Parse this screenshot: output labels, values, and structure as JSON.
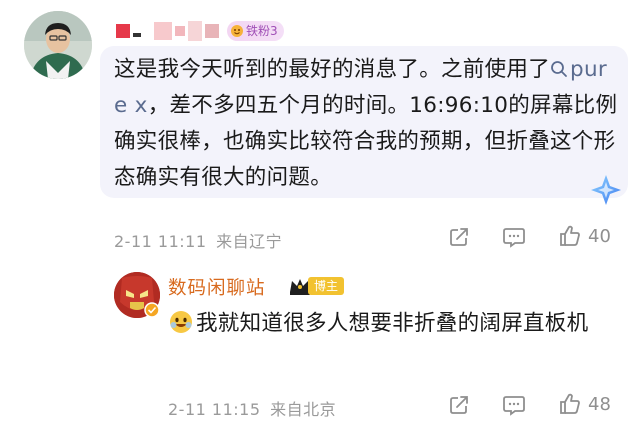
{
  "comment": {
    "user_badge": "铁粉3",
    "text_before_chip": "这是我今天听到的最好的消息了。之前使用了",
    "chip_text": "pure x",
    "text_after_chip": "，差不多四五个月的时间。16:96:10的屏幕比例确实很棒，也确实比较符合我的预期，但折叠这个形态确实有很大的问题。",
    "time": "2-11 11:11",
    "location": "来自辽宁",
    "like_count": "40"
  },
  "reply": {
    "username": "数码闲聊站",
    "host_label": "博主",
    "text": "我就知道很多人想要非折叠的阔屏直板机",
    "time": "2-11 11:15",
    "location": "来自北京",
    "like_count": "48"
  },
  "colors": {
    "bubble_bg": "#f3f3fb",
    "reply_name": "#d86a1e",
    "meta_text": "#9a9a9a",
    "host_badge": "#f2c230"
  },
  "icons": {
    "share": "share-icon",
    "comment": "comment-icon",
    "like": "thumbs-up-icon",
    "sparkle": "sparkle-icon",
    "search": "search-icon",
    "emoji": "grinning-emoji-icon",
    "badge": "fan-badge-icon"
  }
}
